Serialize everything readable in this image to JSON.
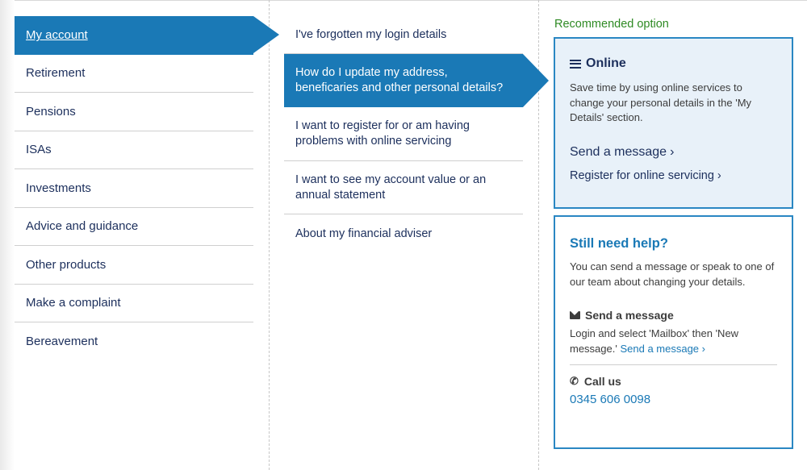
{
  "nav_primary": {
    "items": [
      {
        "label": "My account",
        "active": true
      },
      {
        "label": "Retirement"
      },
      {
        "label": "Pensions"
      },
      {
        "label": "ISAs"
      },
      {
        "label": "Investments"
      },
      {
        "label": "Advice and guidance"
      },
      {
        "label": "Other products"
      },
      {
        "label": "Make a complaint"
      },
      {
        "label": "Bereavement"
      }
    ]
  },
  "nav_secondary": {
    "items": [
      {
        "label": "I've forgotten my login details"
      },
      {
        "label": "How do I update my address, beneficaries and other personal details?",
        "active": true
      },
      {
        "label": "I want to register for or am having problems with online servicing"
      },
      {
        "label": "I want to see my account value or an annual statement"
      },
      {
        "label": "About my financial adviser"
      }
    ]
  },
  "recommended": {
    "label": "Recommended option",
    "title": "Online",
    "text": "Save time by using online services to change your personal details in the 'My Details' section.",
    "link_send": "Send a message",
    "link_register": "Register for online servicing",
    "chevron": "›"
  },
  "help": {
    "title": "Still need help?",
    "text": "You can send a message or speak to one of our team about changing your details.",
    "message_title": "Send a message",
    "message_text": "Login and select 'Mailbox' then 'New message.'",
    "message_link": "Send a message",
    "call_title": "Call us",
    "phone": "0345 606 0098",
    "phone_icon": "phone-icon"
  },
  "colors": {
    "accent": "#1a79b6",
    "navy": "#1c2f5c",
    "recommended_green": "#2e8a23",
    "online_card_bg": "#e8f1f9"
  }
}
